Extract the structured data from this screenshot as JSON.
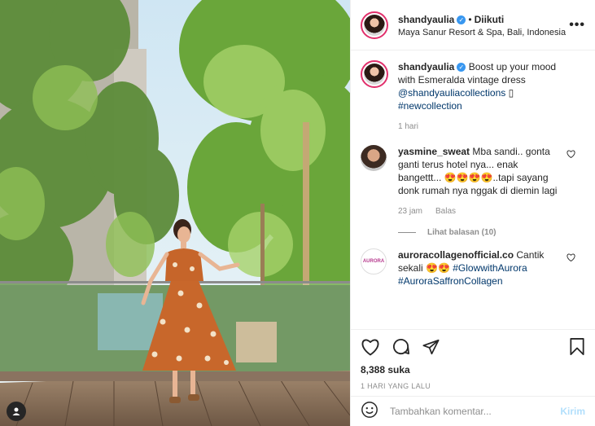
{
  "post": {
    "username": "shandyaulia",
    "follow_separator": "•",
    "follow_status": "Diikuti",
    "location": "Maya Sanur Resort & Spa, Bali, Indonesia",
    "more_icon": "more-horizontal-icon"
  },
  "caption": {
    "username": "shandyaulia",
    "text": "Boost up your mood with Esmeralda vintage dress",
    "mention": "@shandyauliacollections",
    "after_mention": " ▯",
    "hashtag": "#newcollection",
    "age": "1 hari"
  },
  "comments": [
    {
      "username": "yasmine_sweat",
      "text": "Mba sandi.. gonta ganti terus hotel nya... enak bangettt... 😍😍😍😍..tapi sayang donk rumah nya nggak di diemin lagi",
      "age": "23 jam",
      "reply_label": "Balas",
      "view_replies": "Lihat balasan (10)"
    },
    {
      "username": "auroracollagenofficial.co",
      "text": "Cantik sekali 😍😍",
      "tag1": "#GlowwithAurora",
      "tag2": "#AuroraSaffronCollagen"
    }
  ],
  "likes": "8,388 suka",
  "timestamp": "1 HARI YANG LALU",
  "add_comment": {
    "placeholder": "Tambahkan komentar...",
    "post_label": "Kirim"
  },
  "colors": {
    "accent": "#3897f0",
    "link": "#00376b",
    "muted": "#8e8e8e"
  }
}
